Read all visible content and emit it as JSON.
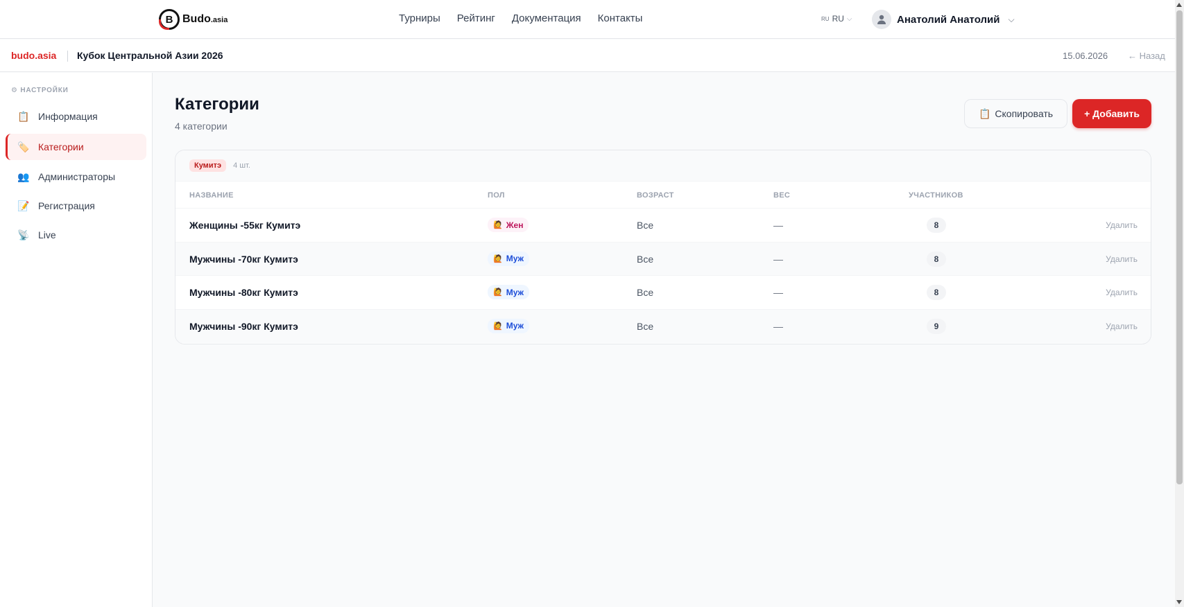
{
  "topnav": {
    "logo_text": "Budo",
    "logo_suffix": ".asia",
    "links": [
      "Турниры",
      "Рейтинг",
      "Документация",
      "Контакты"
    ],
    "lang_flag": "RU",
    "lang_label": "RU",
    "user_name": "Анатолий Анатолий"
  },
  "subheader": {
    "brand": "budo.asia",
    "tournament": "Кубок Центральной Азии 2026",
    "date": "15.06.2026",
    "back": "← Назад"
  },
  "sidebar": {
    "heading": "⚙ НАСТРОЙКИ",
    "items": [
      {
        "label": "Информация",
        "icon": "📋"
      },
      {
        "label": "Категории",
        "icon": "🏷️",
        "active": true
      },
      {
        "label": "Администраторы",
        "icon": "👥"
      },
      {
        "label": "Регистрация",
        "icon": "📝"
      },
      {
        "label": "Live",
        "icon": "📡"
      }
    ]
  },
  "main": {
    "title": "Категории",
    "subtitle": "4 категории",
    "copy_icon": "📋",
    "copy_label": "Скопировать",
    "add_label": "+ Добавить"
  },
  "group": {
    "chip": "Кумитэ",
    "count": "4 шт.",
    "columns": [
      "НАЗВАНИЕ",
      "ПОЛ",
      "ВОЗРАСТ",
      "ВЕС",
      "УЧАСТНИКОВ"
    ],
    "rows": [
      {
        "name": "Женщины -55кг Кумитэ",
        "gender": "Жен",
        "gender_icon": "🙋",
        "age": "Все",
        "weight": "—",
        "participants": "8",
        "action": "Удалить"
      },
      {
        "name": "Мужчины -70кг Кумитэ",
        "gender": "Муж",
        "gender_icon": "🙋",
        "age": "Все",
        "weight": "—",
        "participants": "8",
        "action": "Удалить"
      },
      {
        "name": "Мужчины -80кг Кумитэ",
        "gender": "Муж",
        "gender_icon": "🙋",
        "age": "Все",
        "weight": "—",
        "participants": "8",
        "action": "Удалить"
      },
      {
        "name": "Мужчины -90кг Кумитэ",
        "gender": "Муж",
        "gender_icon": "🙋",
        "age": "Все",
        "weight": "—",
        "participants": "9",
        "action": "Удалить"
      }
    ]
  },
  "colors": {
    "accent": "#dc2626",
    "female": "#be185d",
    "male": "#1d4ed8"
  }
}
